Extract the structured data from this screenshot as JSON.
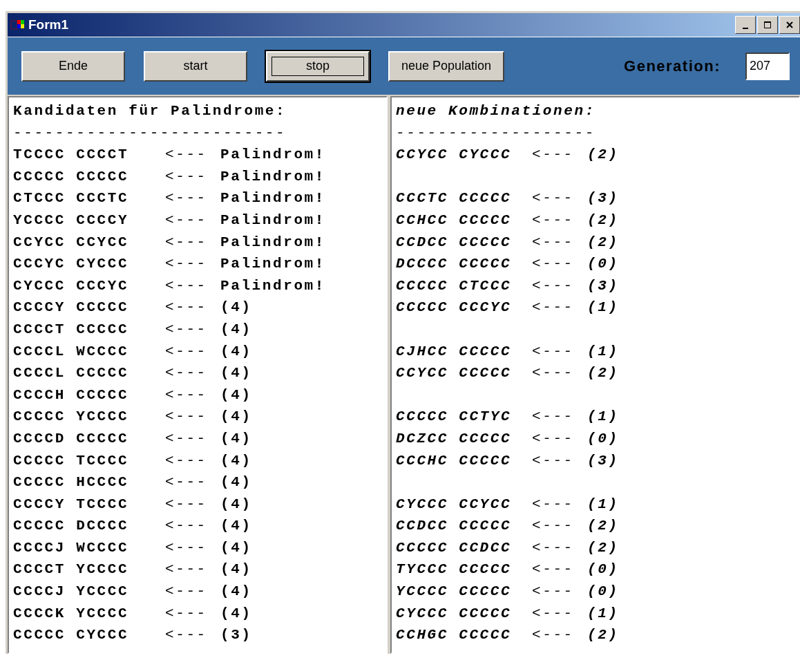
{
  "window": {
    "title": "Form1"
  },
  "toolbar": {
    "buttons": [
      {
        "label": "Ende",
        "focused": false
      },
      {
        "label": "start",
        "focused": false
      },
      {
        "label": "stop",
        "focused": true
      },
      {
        "label": "neue Population",
        "focused": false
      }
    ],
    "generation_label": "Generation:",
    "generation_value": "207"
  },
  "panes": [
    {
      "heading": "Kandidaten für Palindrome:",
      "rule": "--------------------------",
      "lines": [
        {
          "kind": "entry",
          "code": "TCCCC CCCCT",
          "arrow": "<---",
          "result": "Palindrom!"
        },
        {
          "kind": "entry",
          "code": "CCCCC CCCCC",
          "arrow": "<---",
          "result": "Palindrom!"
        },
        {
          "kind": "entry",
          "code": "CTCCC CCCTC",
          "arrow": "<---",
          "result": "Palindrom!"
        },
        {
          "kind": "entry",
          "code": "YCCCC CCCCY",
          "arrow": "<---",
          "result": "Palindrom!"
        },
        {
          "kind": "entry",
          "code": "CCYCC CCYCC",
          "arrow": "<---",
          "result": "Palindrom!"
        },
        {
          "kind": "entry",
          "code": "CCCYC CYCCC",
          "arrow": "<---",
          "result": "Palindrom!"
        },
        {
          "kind": "entry",
          "code": "CYCCC CCCYC",
          "arrow": "<---",
          "result": "Palindrom!"
        },
        {
          "kind": "entry",
          "code": "CCCCY CCCCC",
          "arrow": "<---",
          "result": "(4)"
        },
        {
          "kind": "entry",
          "code": "CCCCT CCCCC",
          "arrow": "<---",
          "result": "(4)"
        },
        {
          "kind": "entry",
          "code": "CCCCL WCCCC",
          "arrow": "<---",
          "result": "(4)"
        },
        {
          "kind": "entry",
          "code": "CCCCL CCCCC",
          "arrow": "<---",
          "result": "(4)"
        },
        {
          "kind": "entry",
          "code": "CCCCH CCCCC",
          "arrow": "<---",
          "result": "(4)"
        },
        {
          "kind": "entry",
          "code": "CCCCC YCCCC",
          "arrow": "<---",
          "result": "(4)"
        },
        {
          "kind": "entry",
          "code": "CCCCD CCCCC",
          "arrow": "<---",
          "result": "(4)"
        },
        {
          "kind": "entry",
          "code": "CCCCC TCCCC",
          "arrow": "<---",
          "result": "(4)"
        },
        {
          "kind": "entry",
          "code": "CCCCC HCCCC",
          "arrow": "<---",
          "result": "(4)"
        },
        {
          "kind": "entry",
          "code": "CCCCY TCCCC",
          "arrow": "<---",
          "result": "(4)"
        },
        {
          "kind": "entry",
          "code": "CCCCC DCCCC",
          "arrow": "<---",
          "result": "(4)"
        },
        {
          "kind": "entry",
          "code": "CCCCJ WCCCC",
          "arrow": "<---",
          "result": "(4)"
        },
        {
          "kind": "entry",
          "code": "CCCCT YCCCC",
          "arrow": "<---",
          "result": "(4)"
        },
        {
          "kind": "entry",
          "code": "CCCCJ YCCCC",
          "arrow": "<---",
          "result": "(4)"
        },
        {
          "kind": "entry",
          "code": "CCCCK YCCCC",
          "arrow": "<---",
          "result": "(4)"
        },
        {
          "kind": "entry",
          "code": "CCCCC CYCCC",
          "arrow": "<---",
          "result": "(3)"
        }
      ]
    },
    {
      "heading": "neue Kombinationen:",
      "rule": "-------------------",
      "lines": [
        {
          "kind": "entry",
          "code": "CCYCC CYCCC",
          "arrow": "<---",
          "result": "(2)"
        },
        {
          "kind": "blank"
        },
        {
          "kind": "entry",
          "code": "CCCTC CCCCC",
          "arrow": "<---",
          "result": "(3)"
        },
        {
          "kind": "entry",
          "code": "CCHCC CCCCC",
          "arrow": "<---",
          "result": "(2)"
        },
        {
          "kind": "entry",
          "code": "CCDCC CCCCC",
          "arrow": "<---",
          "result": "(2)"
        },
        {
          "kind": "entry",
          "code": "DCCCC CCCCC",
          "arrow": "<---",
          "result": "(0)"
        },
        {
          "kind": "entry",
          "code": "CCCCC CTCCC",
          "arrow": "<---",
          "result": "(3)"
        },
        {
          "kind": "entry",
          "code": "CCCCC CCCYC",
          "arrow": "<---",
          "result": "(1)"
        },
        {
          "kind": "blank"
        },
        {
          "kind": "entry",
          "code": "CJHCC CCCCC",
          "arrow": "<---",
          "result": "(1)"
        },
        {
          "kind": "entry",
          "code": "CCYCC CCCCC",
          "arrow": "<---",
          "result": "(2)"
        },
        {
          "kind": "blank"
        },
        {
          "kind": "entry",
          "code": "CCCCC CCTYC",
          "arrow": "<---",
          "result": "(1)"
        },
        {
          "kind": "entry",
          "code": "DCZCC CCCCC",
          "arrow": "<---",
          "result": "(0)"
        },
        {
          "kind": "entry",
          "code": "CCCHC CCCCC",
          "arrow": "<---",
          "result": "(3)"
        },
        {
          "kind": "blank"
        },
        {
          "kind": "entry",
          "code": "CYCCC CCYCC",
          "arrow": "<---",
          "result": "(1)"
        },
        {
          "kind": "entry",
          "code": "CCDCC CCCCC",
          "arrow": "<---",
          "result": "(2)"
        },
        {
          "kind": "entry",
          "code": "CCCCC CCDCC",
          "arrow": "<---",
          "result": "(2)"
        },
        {
          "kind": "entry",
          "code": "TYCCC CCCCC",
          "arrow": "<---",
          "result": "(0)"
        },
        {
          "kind": "entry",
          "code": "YCCCC CCCCC",
          "arrow": "<---",
          "result": "(0)"
        },
        {
          "kind": "entry",
          "code": "CYCCC CCCCC",
          "arrow": "<---",
          "result": "(1)"
        },
        {
          "kind": "entry",
          "code": "CCHGC CCCCC",
          "arrow": "<---",
          "result": "(2)"
        }
      ]
    }
  ]
}
